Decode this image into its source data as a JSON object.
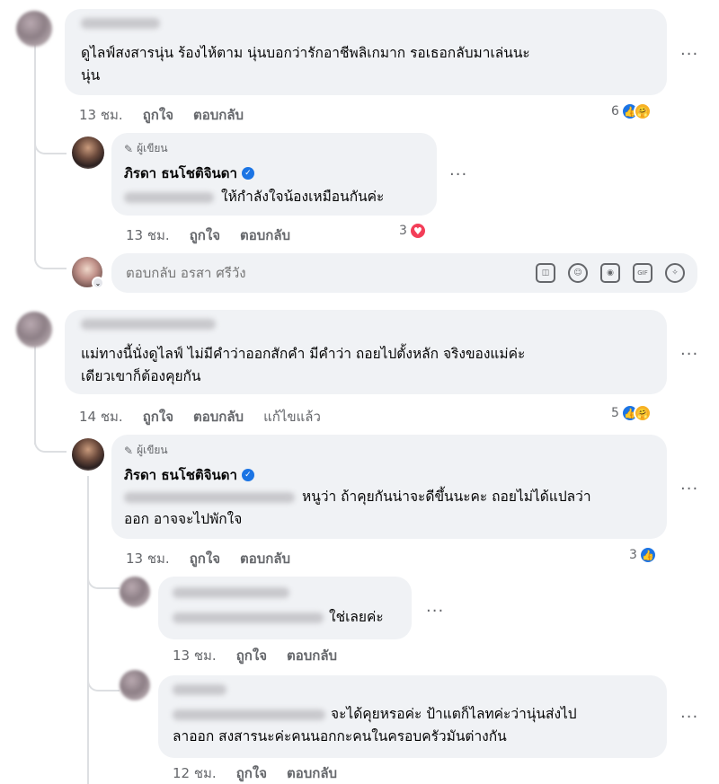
{
  "comments": [
    {
      "text": "ดูไลฟ์สงสารนุ่น ร้องไห้ตาม นุ่นบอกว่ารักอาชีพลิเกมาก รอเธอกลับมาเล่นนะนุ่น",
      "line1": "ดูไลฟ์สงสารนุ่น ร้องไห้ตาม นุ่นบอกว่ารักอาชีพลิเกมาก รอเธอกลับมาเล่นนะ",
      "line2": "นุ่น",
      "time": "13 ชม.",
      "like": "ถูกใจ",
      "reply": "ตอบกลับ",
      "reaction_count": "6"
    },
    {
      "line1": "แม่ทางนี้นั่งดูไลฟ์ ไม่มีคำว่าออกสักคำ มีคำว่า ถอยไปตั้งหลัก จริงของแม่ค่ะ",
      "line2": "เดียวเขาก็ต้องคุยกัน",
      "time": "14 ชม.",
      "like": "ถูกใจ",
      "reply": "ตอบกลับ",
      "edited": "แก้ไขแล้ว",
      "reaction_count": "5"
    }
  ],
  "author_replies": [
    {
      "author_tag": "ผู้เขียน",
      "author_name": "ภิรดา ธนโชติจินดา",
      "text": "ให้กำลังใจน้องเหมือนกันค่ะ",
      "time": "13 ชม.",
      "like": "ถูกใจ",
      "reply": "ตอบกลับ",
      "reaction_count": "3"
    },
    {
      "author_tag": "ผู้เขียน",
      "author_name": "ภิรดา ธนโชติจินดา",
      "line1": "หนูว่า ถ้าคุยกันน่าจะดีขึ้นนะคะ ถอยไม่ได้แปลว่า",
      "line2": "ออก อาจจะไปพักใจ",
      "time": "13 ชม.",
      "like": "ถูกใจ",
      "reply": "ตอบกลับ",
      "reaction_count": "3"
    }
  ],
  "reply_input": {
    "placeholder": "ตอบกลับ อรสา ศรีวัง"
  },
  "sub_replies": [
    {
      "text": "ใช่เลยค่ะ",
      "time": "13 ชม.",
      "like": "ถูกใจ",
      "reply": "ตอบกลับ"
    },
    {
      "line1": "จะได้คุยหรอค่ะ ป้าแตก็ไลทค่ะว่านุ่นส่งไป",
      "line2": "ลาออก สงสารนะค่ะคนนอกกะคนในครอบครัวมันต่างกัน",
      "time": "12 ชม.",
      "like": "ถูกใจ",
      "reply": "ตอบกลับ"
    }
  ],
  "more_label": "···",
  "icons": [
    "like-icon",
    "care-icon",
    "love-icon",
    "verified-icon",
    "pencil-icon",
    "sticker-icon",
    "emoji-icon",
    "camera-icon",
    "gif-icon",
    "avatar-sticker-icon"
  ],
  "colors": {
    "accent": "#1b74e4",
    "bubble": "#f0f2f5",
    "meta": "#65676b",
    "love": "#f33e58",
    "care": "#f7b125"
  }
}
